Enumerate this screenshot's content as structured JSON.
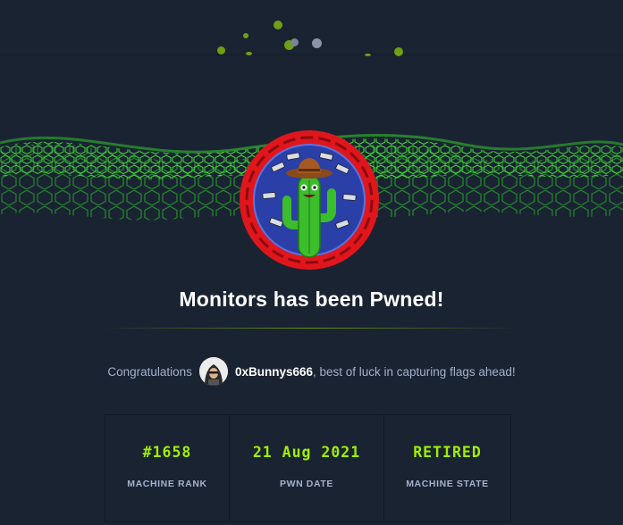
{
  "header": {
    "title": "Monitors has been Pwned!"
  },
  "congrats": {
    "prefix": "Congratulations",
    "username": "0xBunnys666",
    "suffix": ", best of luck in capturing flags ahead!"
  },
  "stats": [
    {
      "value": "#1658",
      "label": "MACHINE RANK"
    },
    {
      "value": "21 Aug 2021",
      "label": "PWN DATE"
    },
    {
      "value": "RETIRED",
      "label": "MACHINE STATE"
    }
  ],
  "colors": {
    "background": "#1a2332",
    "accent": "#9fef00",
    "text_muted": "#a4b1cd",
    "badge_ring": "#e0161c"
  },
  "icons": {
    "machine_avatar": "cactus-cowboy-machine-icon",
    "user_avatar": "hooded-user-avatar"
  }
}
